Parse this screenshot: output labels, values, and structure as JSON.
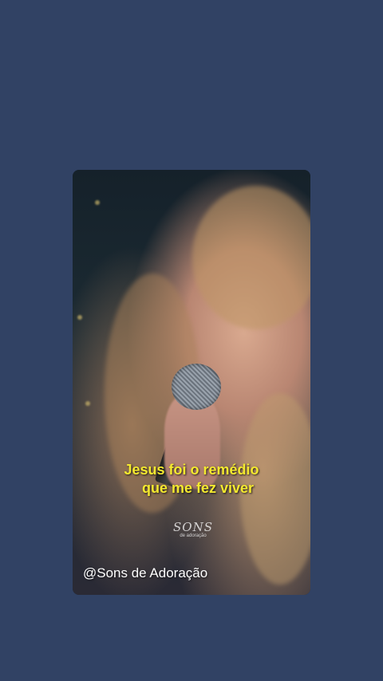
{
  "video": {
    "caption_line1": "Jesus foi o remédio",
    "caption_line2": "que me fez viver",
    "watermark_main": "SONS",
    "watermark_sub": "de adoração",
    "channel_handle": "@Sons de Adoração"
  },
  "colors": {
    "background": "#314264",
    "caption": "#f4e92f",
    "handle": "#ffffff"
  }
}
